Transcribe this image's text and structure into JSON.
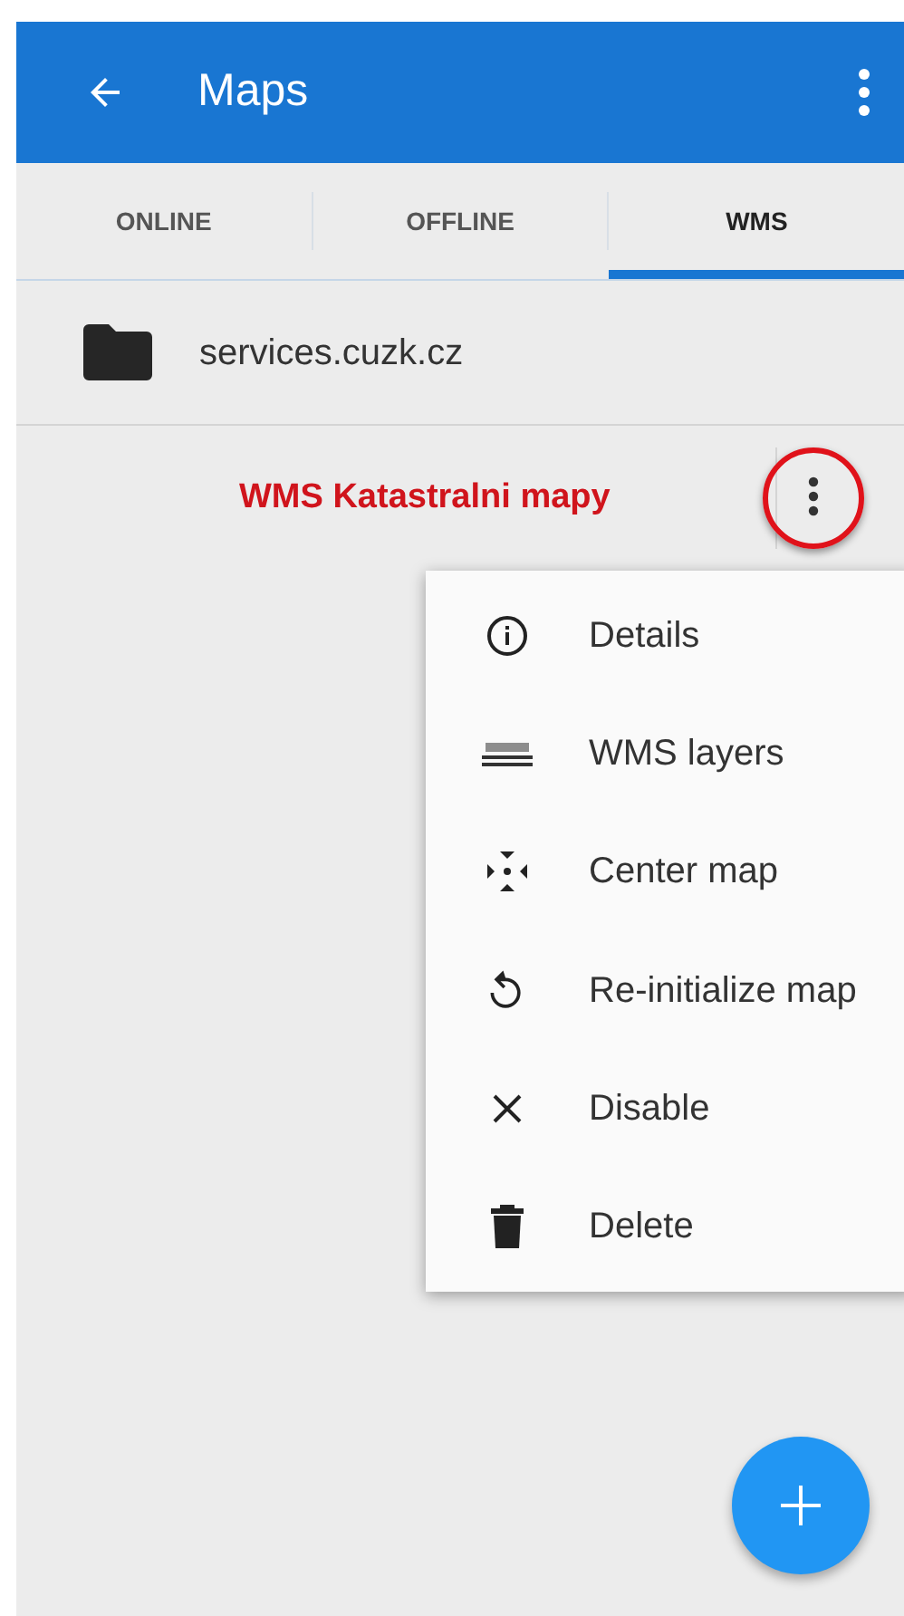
{
  "app_bar": {
    "title": "Maps"
  },
  "tabs": [
    {
      "label": "ONLINE",
      "selected": false
    },
    {
      "label": "OFFLINE",
      "selected": false
    },
    {
      "label": "WMS",
      "selected": true
    }
  ],
  "folder": {
    "name": "services.cuzk.cz"
  },
  "wms_item": {
    "name": "WMS Katastralni mapy",
    "menu_button_circled": true
  },
  "context_menu": [
    {
      "kind": "info",
      "label": "Details"
    },
    {
      "kind": "layers",
      "label": "WMS layers"
    },
    {
      "kind": "center",
      "label": "Center map"
    },
    {
      "kind": "refresh",
      "label": "Re-initialize map"
    },
    {
      "kind": "close",
      "label": "Disable"
    },
    {
      "kind": "delete",
      "label": "Delete"
    }
  ]
}
